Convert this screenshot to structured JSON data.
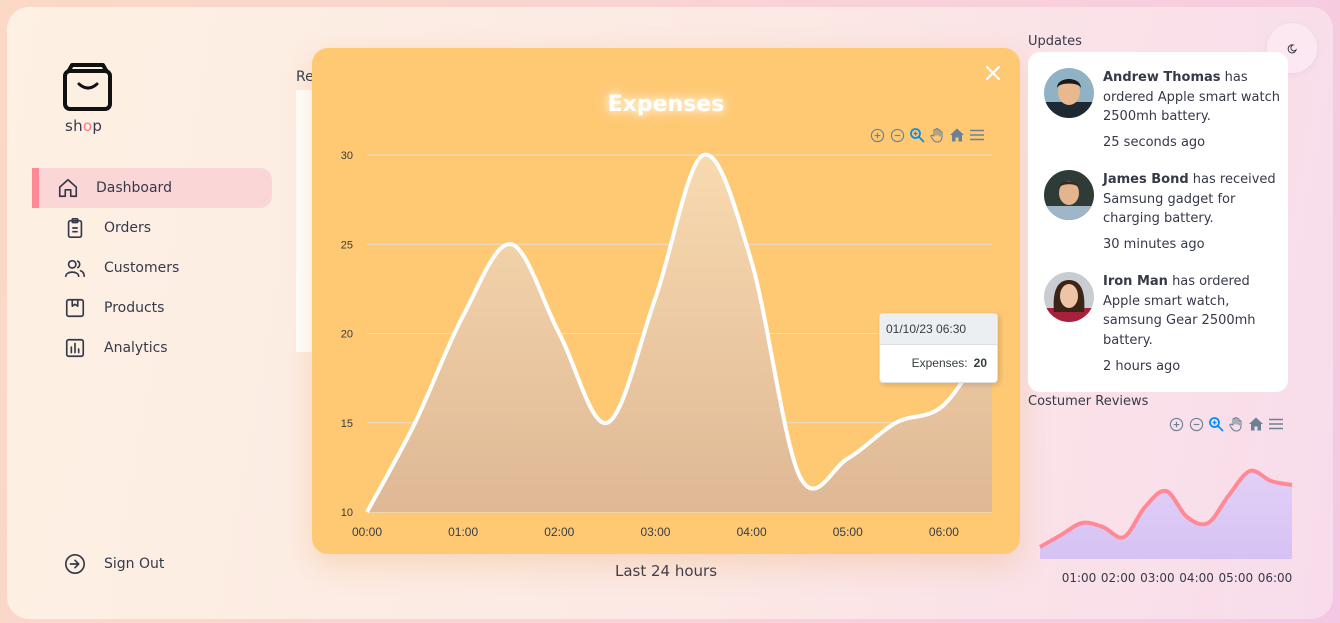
{
  "brand": {
    "name_prefix": "sh",
    "name_o": "o",
    "name_suffix": "p"
  },
  "sidebar": {
    "items": [
      {
        "label": "Dashboard",
        "icon": "home-icon",
        "active": true
      },
      {
        "label": "Orders",
        "icon": "clipboard-icon",
        "active": false
      },
      {
        "label": "Customers",
        "icon": "users-icon",
        "active": false
      },
      {
        "label": "Products",
        "icon": "box-icon",
        "active": false
      },
      {
        "label": "Analytics",
        "icon": "bar-chart-icon",
        "active": false
      }
    ],
    "signout": "Sign Out"
  },
  "main": {
    "recent_label": "Re",
    "period_label": "Last 24 hours"
  },
  "modal": {
    "title": "Expenses",
    "tooltip": {
      "header": "01/10/23 06:30",
      "series": "Expenses:",
      "value": "20"
    }
  },
  "chart_data": [
    {
      "type": "area",
      "title": "Expenses",
      "series": [
        {
          "name": "Expenses",
          "x": [
            "00:00",
            "00:30",
            "01:00",
            "01:30",
            "02:00",
            "02:30",
            "03:00",
            "03:30",
            "04:00",
            "04:30",
            "05:00",
            "05:30",
            "06:00",
            "06:30"
          ],
          "values": [
            10,
            15,
            21,
            25,
            20,
            15,
            22,
            30,
            24,
            12,
            13,
            15,
            16,
            20
          ]
        }
      ],
      "xticks": [
        "00:00",
        "01:00",
        "02:00",
        "03:00",
        "04:00",
        "05:00",
        "06:00"
      ],
      "yticks": [
        10,
        15,
        20,
        25,
        30
      ],
      "ylim": [
        10,
        30
      ],
      "grid": true,
      "colors": {
        "line": "#ffffff",
        "fill_top": "#f8dbb3",
        "fill_bottom": "#ddb797",
        "background": "#ffc974"
      }
    },
    {
      "type": "area",
      "title": "Costumer Reviews",
      "series": [
        {
          "name": "Reviews",
          "x": [
            "00:30",
            "01:00",
            "01:30",
            "02:00",
            "02:30",
            "03:00",
            "03:30",
            "04:00",
            "04:30",
            "05:00",
            "05:30",
            "06:00",
            "06:30"
          ],
          "values": [
            2,
            8,
            14,
            12,
            7,
            22,
            30,
            17,
            14,
            28,
            40,
            35,
            33
          ]
        }
      ],
      "xticks": [
        "01:00",
        "02:00",
        "03:00",
        "04:00",
        "05:00",
        "06:00"
      ],
      "colors": {
        "line": "#ff8a95",
        "fill_top": "#e2d0f7",
        "fill_bottom": "#d6c2f4"
      }
    }
  ],
  "updates": {
    "title": "Updates",
    "items": [
      {
        "name": "Andrew Thomas",
        "text": " has ordered Apple smart watch 2500mh battery.",
        "time": "25 seconds ago"
      },
      {
        "name": "James Bond",
        "text": " has received Samsung gadget for charging battery.",
        "time": "30 minutes ago"
      },
      {
        "name": "Iron Man",
        "text": " has ordered Apple smart watch, samsung Gear 2500mh battery.",
        "time": "2 hours ago"
      }
    ]
  },
  "reviews": {
    "title": "Costumer Reviews"
  },
  "toolbar_icons": [
    "zoom-in-icon",
    "zoom-out-icon",
    "zoom-select-icon",
    "pan-hand-icon",
    "reset-home-icon",
    "menu-icon"
  ],
  "colors": {
    "accent": "#ff8a95",
    "modal_bg": "#ffc974",
    "zoom_active": "#008ffb"
  }
}
